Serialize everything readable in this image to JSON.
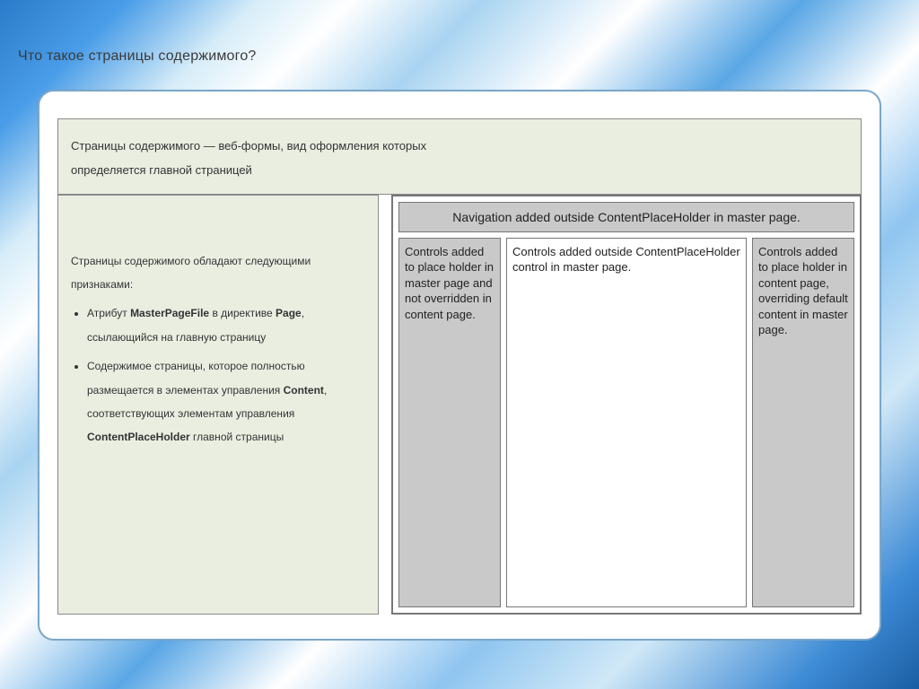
{
  "title": "Что такое страницы содержимого?",
  "intro": {
    "line1": "Страницы содержимого — веб-формы, вид оформления которых",
    "line2": "определяется главной страницей"
  },
  "features": {
    "lead": "Страницы содержимого обладают следующими признаками:",
    "item1_pre": "Атрибут ",
    "item1_b1": "MasterPageFile",
    "item1_mid": " в директиве ",
    "item1_b2": "Page",
    "item1_post": ", ссылающийся на главную страницу",
    "item2_pre": "Содержимое страницы, которое полностью размещается в элементах управления ",
    "item2_b1": "Content",
    "item2_mid": ", соответствующих элементам управления ",
    "item2_b2": "ContentPlaceHolder",
    "item2_post": " главной страницы"
  },
  "diagram": {
    "header": "Navigation added outside ContentPlaceHolder in master page.",
    "cell_left": "Controls added to place holder in master page and not overridden in content page.",
    "cell_mid": "Controls added outside ContentPlaceHolder control in master page.",
    "cell_right": "Controls added to place holder in content page, overriding default content in master page."
  }
}
